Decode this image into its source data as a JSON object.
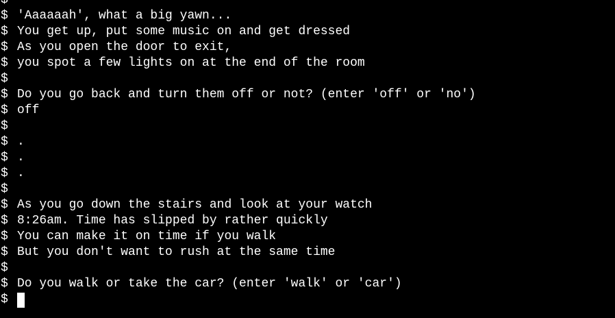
{
  "terminal": {
    "prompt_symbol": "$",
    "lines": [
      "",
      "'Aaaaaah', what a big yawn...",
      "You get up, put some music on and get dressed",
      "As you open the door to exit,",
      "you spot a few lights on at the end of the room",
      "",
      "Do you go back and turn them off or not? (enter 'off' or 'no')",
      "off",
      "",
      ".",
      ".",
      ".",
      "",
      "As you go down the stairs and look at your watch",
      "8:26am. Time has slipped by rather quickly",
      "You can make it on time if you walk",
      "But you don't want to rush at the same time",
      "",
      "Do you walk or take the car? (enter 'walk' or 'car')",
      ""
    ],
    "colors": {
      "background": "#000000",
      "foreground": "#ffffff"
    }
  }
}
